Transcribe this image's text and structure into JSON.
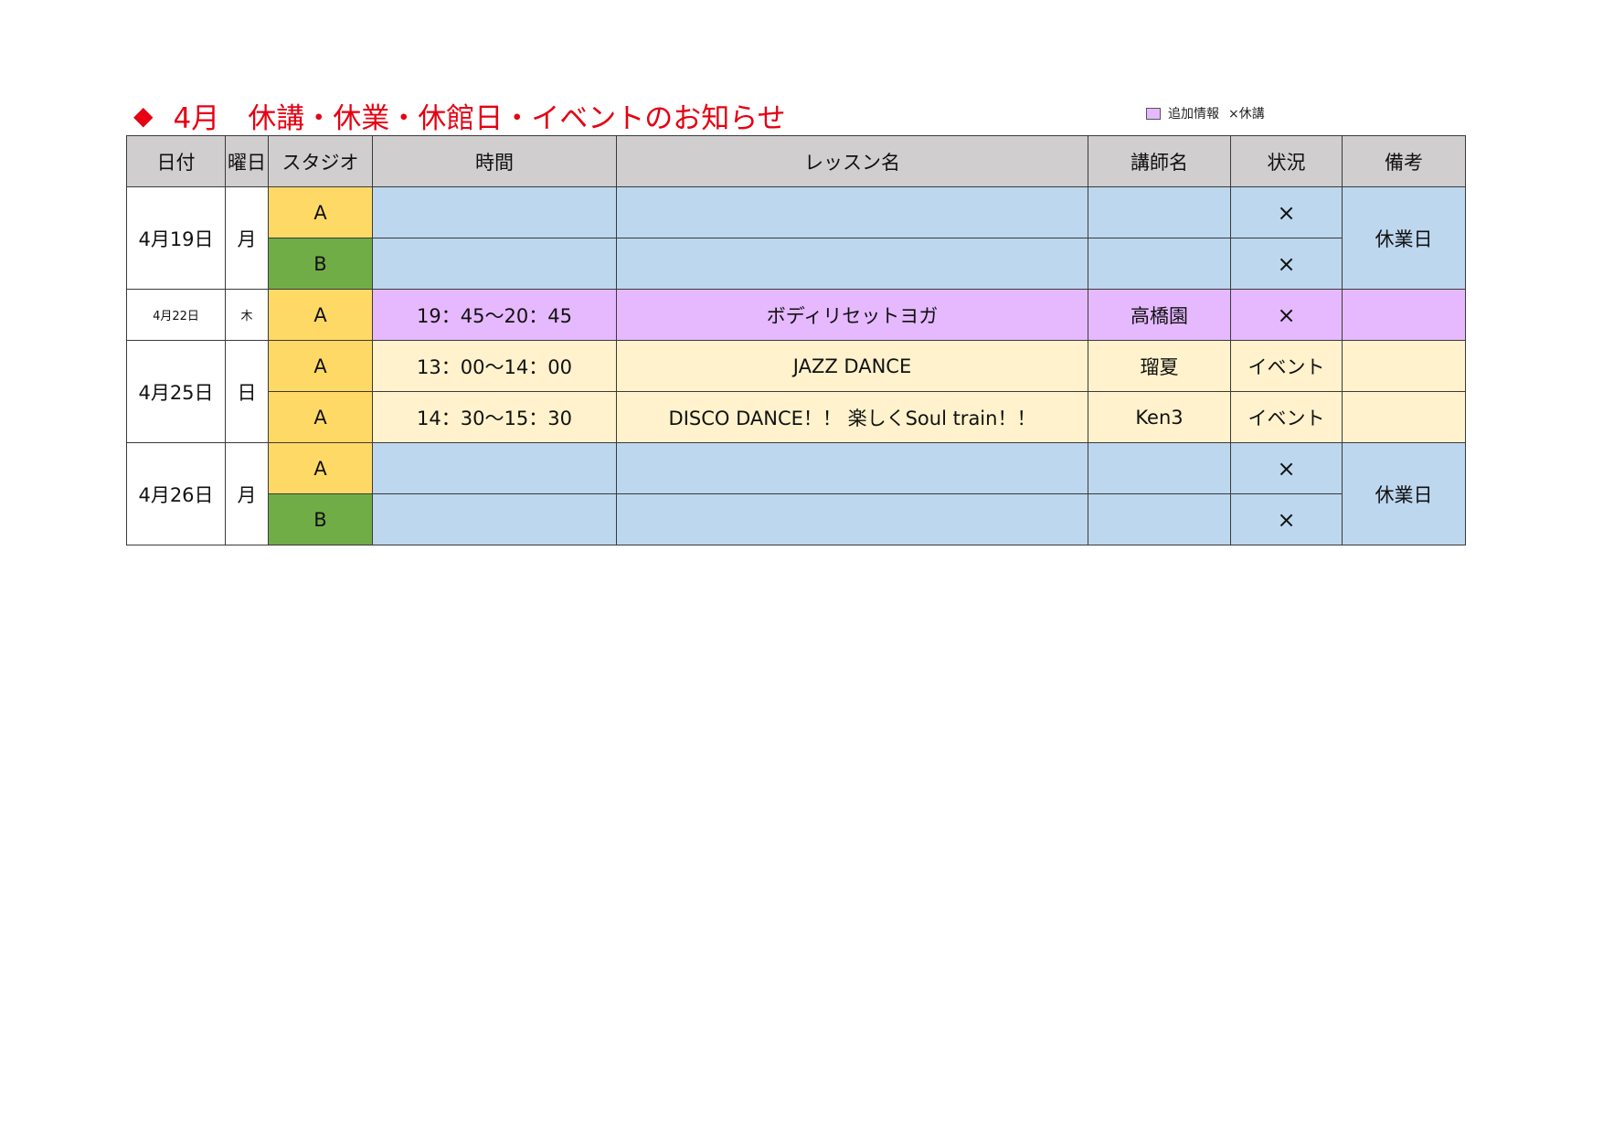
{
  "title": {
    "marker": "◆",
    "text": "4月　休講・休業・休館日・イベントのお知らせ"
  },
  "legend": {
    "swatch_color": "#e6b9ff",
    "label": "追加情報",
    "mark_note": "×休講"
  },
  "table": {
    "headers": {
      "date": "日付",
      "day": "曜日",
      "studio": "スタジオ",
      "time": "時間",
      "lesson": "レッスン名",
      "instructor": "講師名",
      "status": "状況",
      "note": "備考"
    },
    "groups": [
      {
        "date": "4月19日",
        "day": "月",
        "note": "休業日",
        "rows": [
          {
            "studio": "A",
            "time": "",
            "lesson": "",
            "instructor": "",
            "status": "×"
          },
          {
            "studio": "B",
            "time": "",
            "lesson": "",
            "instructor": "",
            "status": "×"
          }
        ]
      },
      {
        "date": "4月22日",
        "day": "木",
        "note": "",
        "rows": [
          {
            "studio": "A",
            "time": "19：45～20：45",
            "lesson": "ボディリセットヨガ",
            "instructor": "高橋園",
            "status": "×"
          }
        ]
      },
      {
        "date": "4月25日",
        "day": "日",
        "note": "",
        "rows": [
          {
            "studio": "A",
            "time": "13：00～14：00",
            "lesson": "JAZZ DANCE",
            "instructor": "瑠夏",
            "status": "イベント",
            "note": ""
          },
          {
            "studio": "A",
            "time": "14：30～15：30",
            "lesson": "DISCO DANCE！！ 楽しくSoul train！！",
            "instructor": "Ken3",
            "status": "イベント",
            "note": ""
          }
        ]
      },
      {
        "date": "4月26日",
        "day": "月",
        "note": "休業日",
        "rows": [
          {
            "studio": "A",
            "time": "",
            "lesson": "",
            "instructor": "",
            "status": "×"
          },
          {
            "studio": "B",
            "time": "",
            "lesson": "",
            "instructor": "",
            "status": "×"
          }
        ]
      }
    ]
  },
  "colors": {
    "title_red": "#e60012",
    "header_gray": "#d0cece",
    "studio_a_yellow": "#ffd966",
    "studio_b_green": "#70ad47",
    "closed_blue": "#bdd7ee",
    "added_purple": "#e6b9ff",
    "event_beige": "#fff2cc"
  }
}
